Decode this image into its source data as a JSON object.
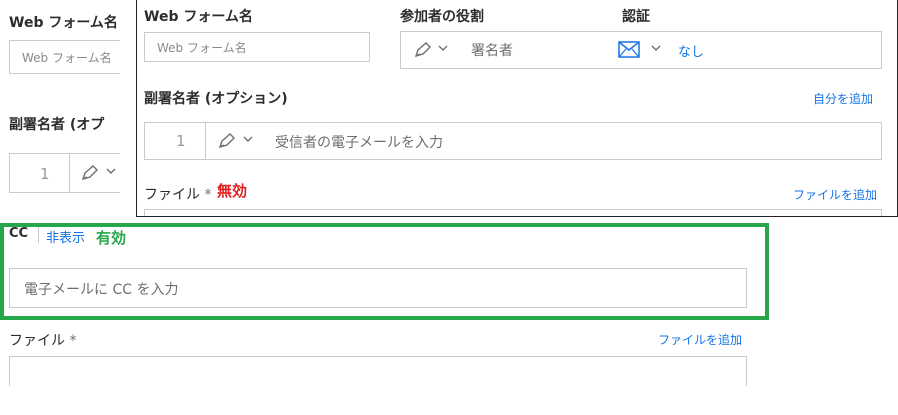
{
  "background": {
    "web_form_name_label": "Web フォーム名",
    "web_form_name_placeholder": "Web フォーム名",
    "cosigner_label": "副署名者 (オプ",
    "cosigner_index": "1",
    "cc_label": "CC",
    "cc_hide_link": "非表示",
    "cc_annotation": "有効",
    "cc_input_placeholder": "電子メールに CC を入力",
    "file_label": "ファイル",
    "file_required_mark": "*",
    "add_file_link": "ファイルを追加"
  },
  "overlay": {
    "web_form_name_label": "Web フォーム名",
    "web_form_name_placeholder": "Web フォーム名",
    "participant_role_label": "参加者の役割",
    "role_value": "署名者",
    "authentication_label": "認証",
    "auth_value": "なし",
    "cosigner_label": "副署名者 (オプション)",
    "add_self_link": "自分を追加",
    "cosigner_index": "1",
    "cosigner_email_placeholder": "受信者の電子メールを入力",
    "file_label": "ファイル",
    "file_required_mark": "*",
    "file_annotation": "無効",
    "add_file_link": "ファイルを追加"
  },
  "colors": {
    "link": "#1473e6",
    "highlight_green": "#26a749",
    "annotation_red": "#e02020"
  }
}
